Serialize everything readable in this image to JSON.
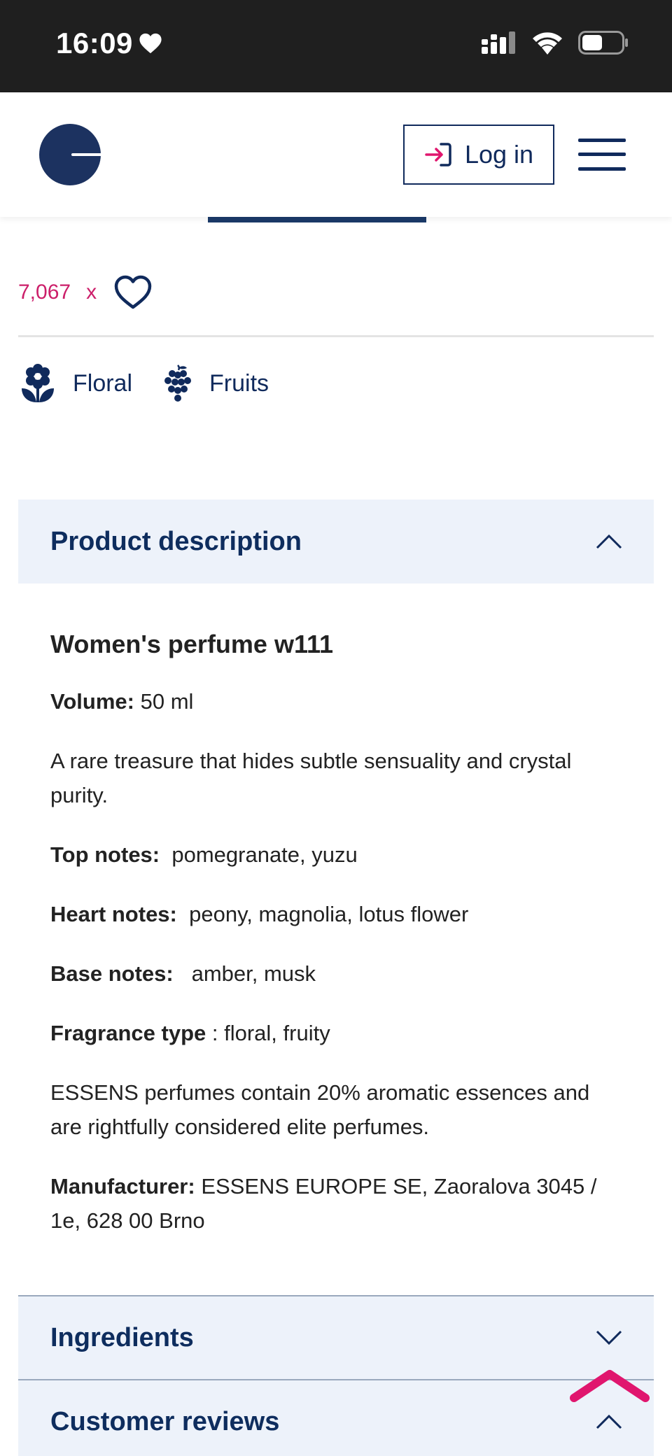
{
  "status_bar": {
    "time": "16:09",
    "icons": [
      "heart-icon",
      "signal-icon",
      "wifi-icon",
      "battery-icon"
    ]
  },
  "header": {
    "login_label": "Log in",
    "icons": [
      "logo",
      "login-arrow-icon",
      "hamburger-menu-icon"
    ]
  },
  "favourites": {
    "count": "7,067",
    "multiplier": "x",
    "icon": "heart-outline-icon"
  },
  "scent_tags": [
    {
      "label": "Floral",
      "icon": "flower-icon"
    },
    {
      "label": "Fruits",
      "icon": "grapes-icon"
    }
  ],
  "product_description": {
    "heading": "Product description",
    "expanded": true,
    "title": "Women's perfume w111",
    "volume_label": "Volume:",
    "volume_value": " 50 ml",
    "tagline": "A rare treasure that hides subtle sensuality and crystal purity.",
    "top_notes_label": "Top notes:",
    "top_notes_value": "  pomegranate, yuzu",
    "heart_notes_label": "Heart notes:",
    "heart_notes_value": "  peony, magnolia, lotus flower",
    "base_notes_label": "Base notes:",
    "base_notes_value": "   amber, musk",
    "fragrance_type_label": "Fragrance type",
    "fragrance_type_value": " : floral, fruity",
    "essens_note": "ESSENS perfumes contain 20% aromatic essences and are rightfully considered elite perfumes.",
    "manufacturer_label": "Manufacturer:",
    "manufacturer_value": " ESSENS EUROPE SE, Zaoralova 3045 / 1e, 628 00 Brno"
  },
  "ingredients": {
    "heading": "Ingredients",
    "expanded": false
  },
  "customer_reviews": {
    "heading": "Customer reviews"
  },
  "colors": {
    "navy": "#102a5c",
    "accent_pink": "#e0166e",
    "count_pink": "#cc1f6a",
    "accordion_bg": "#edf2fa"
  }
}
